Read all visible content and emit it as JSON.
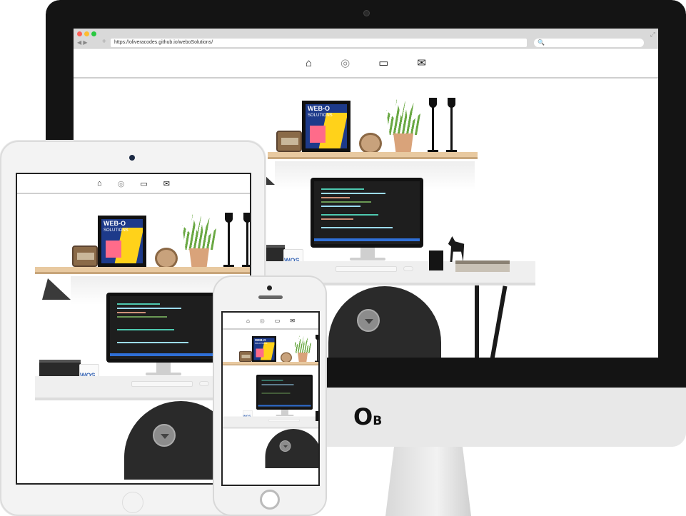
{
  "browser": {
    "url": "https://oliveracodes.github.io/weboSolutions/",
    "back_icon": "◀",
    "forward_icon": "▶",
    "new_tab_icon": "+",
    "search_icon": "🔍",
    "expand_icon": "⤢"
  },
  "site_nav": {
    "items": [
      {
        "icon": "home-icon",
        "glyph": "⌂"
      },
      {
        "icon": "fingerprint-icon",
        "glyph": "◎"
      },
      {
        "icon": "devices-icon",
        "glyph": "▭"
      },
      {
        "icon": "mail-icon",
        "glyph": "✉"
      }
    ]
  },
  "poster": {
    "title": "WEB-O",
    "subtitle": "SOLUTIONS"
  },
  "mug_text": "WOS",
  "imac_logo": {
    "main": "O",
    "sub": "B"
  },
  "colors": {
    "bezel": "#141414",
    "poster_bg": "#1d3a8a",
    "poster_yellow": "#ffd21a",
    "poster_pink": "#ff6b8a",
    "shelf": "#e8c9a0"
  }
}
